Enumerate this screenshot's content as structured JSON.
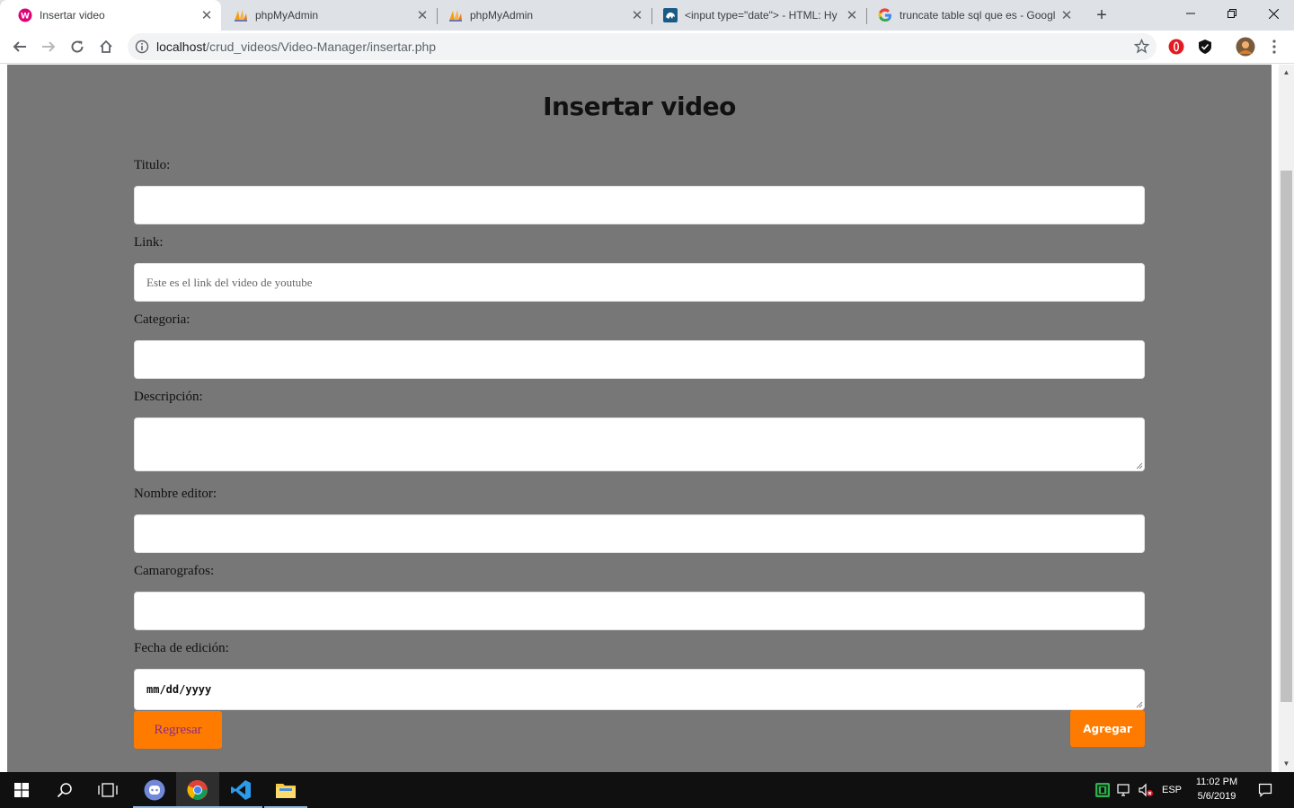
{
  "browser": {
    "tabs": [
      {
        "title": "Insertar video",
        "icon": "wamp-icon",
        "active": true
      },
      {
        "title": "phpMyAdmin",
        "icon": "phpmyadmin-icon",
        "active": false
      },
      {
        "title": "phpMyAdmin",
        "icon": "phpmyadmin-icon",
        "active": false
      },
      {
        "title": "<input type=\"date\"> - HTML: Hy",
        "icon": "mdn-icon",
        "active": false
      },
      {
        "title": "truncate table sql que es - Googl",
        "icon": "google-icon",
        "active": false
      }
    ],
    "url_host": "localhost",
    "url_path": "/crud_videos/Video-Manager/insertar.php"
  },
  "page": {
    "heading": "Insertar video",
    "fields": {
      "titulo": {
        "label": "Titulo:",
        "value": "",
        "placeholder": ""
      },
      "link": {
        "label": "Link:",
        "value": "",
        "placeholder": "Este es el link del video de youtube"
      },
      "categoria": {
        "label": "Categoria:",
        "value": "",
        "placeholder": ""
      },
      "descripcion": {
        "label": "Descripción:",
        "value": "",
        "placeholder": ""
      },
      "editor": {
        "label": "Nombre editor:",
        "value": "",
        "placeholder": ""
      },
      "camarografos": {
        "label": "Camarografos:",
        "value": "",
        "placeholder": ""
      },
      "fecha": {
        "label": "Fecha de edición:",
        "value": "mm/dd/yyyy"
      }
    },
    "buttons": {
      "back": "Regresar",
      "submit": "Agregar"
    },
    "colors": {
      "background": "#777777",
      "button": "#ff7b00",
      "back_text": "#8b2c8a"
    }
  },
  "taskbar": {
    "apps": [
      "start-icon",
      "search-icon",
      "task-view-icon",
      "discord-icon",
      "chrome-icon",
      "vscode-icon",
      "file-explorer-icon"
    ],
    "language": "ESP",
    "time": "11:02 PM",
    "date": "5/6/2019"
  }
}
